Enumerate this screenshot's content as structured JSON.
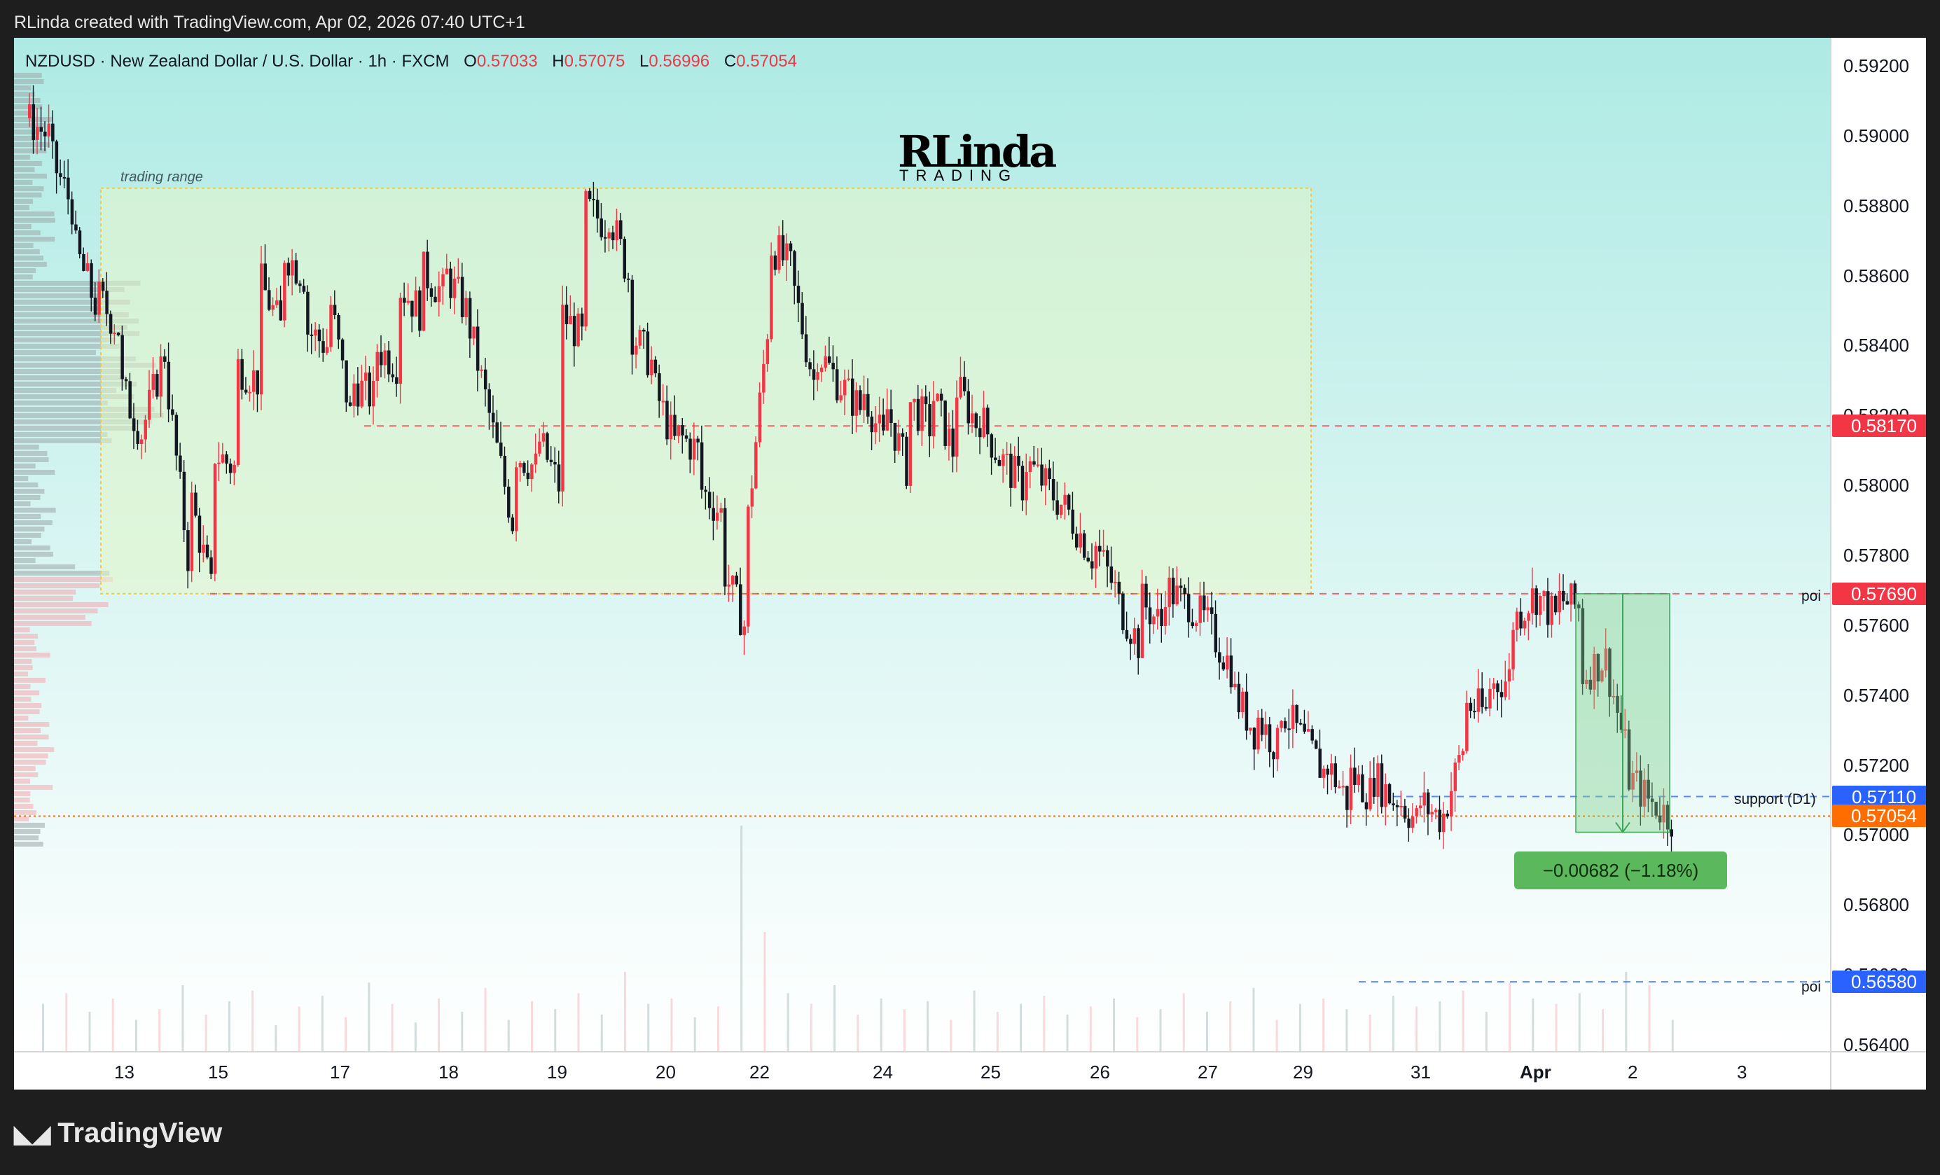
{
  "header": {
    "attribution": "RLinda created with TradingView.com, Apr 02, 2026 07:40 UTC+1"
  },
  "legend": {
    "title": "NZDUSD · New Zealand Dollar / U.S. Dollar · 1h · FXCM",
    "open_label": "O",
    "open": "0.57033",
    "high_label": "H",
    "high": "0.57075",
    "low_label": "L",
    "low": "0.56996",
    "close_label": "C",
    "close": "0.57054"
  },
  "brand": {
    "logo_letters": "RLinda",
    "logo_sub": "TRADING"
  },
  "annotations": {
    "trading_range": "trading range",
    "poi_upper": "poi",
    "support": "support (D1)",
    "poi_lower": "poi",
    "measure": "−0.00682 (−1.18%)"
  },
  "price_tags": {
    "level_1": "0.58170",
    "level_2": "0.57690",
    "support": "0.57110",
    "last": "0.57054",
    "level_3": "0.56580"
  },
  "footer": {
    "logo": "TradingView"
  },
  "colors": {
    "up": "#f23645",
    "down": "#131722",
    "level_red": "#f23645",
    "level_blue": "#2962ff",
    "last_price": "#ff6d00",
    "range_border": "#f5c842",
    "measure_fill": "#7fd08a",
    "measure_label": "#5cb85c"
  },
  "chart_data": {
    "type": "candlestick",
    "symbol": "NZDUSD",
    "interval": "1h",
    "y_ticks": [
      "0.59200",
      "0.59000",
      "0.58800",
      "0.58600",
      "0.58400",
      "0.58200",
      "0.58000",
      "0.57800",
      "0.57600",
      "0.57400",
      "0.57200",
      "0.57000",
      "0.56800",
      "0.56600",
      "0.56400"
    ],
    "x_ticks": [
      "13",
      "15",
      "17",
      "18",
      "19",
      "20",
      "22",
      "24",
      "25",
      "26",
      "27",
      "29",
      "31",
      "Apr",
      "2",
      "3"
    ],
    "ylim": [
      0.5638,
      0.5928
    ],
    "trading_range": [
      0.5769,
      0.5885
    ],
    "levels": [
      {
        "price": 0.5817,
        "color": "red"
      },
      {
        "price": 0.5769,
        "color": "red",
        "label": "poi"
      },
      {
        "price": 0.5711,
        "color": "blue",
        "label": "support (D1)"
      },
      {
        "price": 0.5658,
        "color": "blue",
        "label": "poi"
      }
    ],
    "measure": {
      "from": 0.5769,
      "to": 0.57008,
      "change": -0.00682,
      "percent": -1.18
    },
    "path": [
      [
        0.5905,
        0.59
      ],
      [
        0.5895,
        0.588
      ],
      [
        0.587,
        0.5852
      ],
      [
        0.5855,
        0.5845
      ],
      [
        0.583,
        0.5815
      ],
      [
        0.5815,
        0.5838
      ],
      [
        0.5835,
        0.578
      ],
      [
        0.58,
        0.577
      ],
      [
        0.581,
        0.5805
      ],
      [
        0.5835,
        0.583
      ],
      [
        0.586,
        0.5845
      ],
      [
        0.5868,
        0.586
      ],
      [
        0.5845,
        0.584
      ],
      [
        0.5858,
        0.582
      ],
      [
        0.583,
        0.5825
      ],
      [
        0.584,
        0.5835
      ],
      [
        0.5858,
        0.585
      ],
      [
        0.5862,
        0.5855
      ],
      [
        0.5862,
        0.585
      ],
      [
        0.585,
        0.582
      ],
      [
        0.582,
        0.579
      ],
      [
        0.581,
        0.5805
      ],
      [
        0.5815,
        0.58
      ],
      [
        0.585,
        0.5842
      ],
      [
        0.588,
        0.5875
      ],
      [
        0.5882,
        0.586
      ],
      [
        0.5845,
        0.5835
      ],
      [
        0.583,
        0.5812
      ],
      [
        0.5815,
        0.581
      ],
      [
        0.58,
        0.5792
      ],
      [
        0.5778,
        0.576
      ],
      [
        0.578,
        0.5845
      ],
      [
        0.587,
        0.5862
      ],
      [
        0.586,
        0.583
      ],
      [
        0.584,
        0.583
      ],
      [
        0.583,
        0.5822
      ],
      [
        0.583,
        0.5812
      ],
      [
        0.5825,
        0.5805
      ],
      [
        0.5825,
        0.5817
      ],
      [
        0.5828,
        0.581
      ],
      [
        0.583,
        0.5818
      ],
      [
        0.5822,
        0.5808
      ],
      [
        0.5808,
        0.58
      ],
      [
        0.5808,
        0.58
      ],
      [
        0.58,
        0.5792
      ],
      [
        0.5792,
        0.578
      ],
      [
        0.5785,
        0.577
      ],
      [
        0.5768,
        0.5755
      ],
      [
        0.5768,
        0.576
      ],
      [
        0.5772,
        0.5766
      ],
      [
        0.5768,
        0.576
      ],
      [
        0.576,
        0.5748
      ],
      [
        0.5742,
        0.573
      ],
      [
        0.5735,
        0.5725
      ],
      [
        0.5738,
        0.5728
      ],
      [
        0.5728,
        0.5718
      ],
      [
        0.5722,
        0.571
      ],
      [
        0.5718,
        0.5712
      ],
      [
        0.5718,
        0.571
      ],
      [
        0.5712,
        0.5704
      ],
      [
        0.571,
        0.5705
      ],
      [
        0.5702,
        0.5725
      ],
      [
        0.5738,
        0.5735
      ],
      [
        0.5742,
        0.5745
      ],
      [
        0.576,
        0.5768
      ],
      [
        0.577,
        0.5762
      ],
      [
        0.5768,
        0.5765
      ],
      [
        0.5745,
        0.575
      ],
      [
        0.5755,
        0.5725
      ],
      [
        0.5718,
        0.571
      ],
      [
        0.571,
        0.5705
      ]
    ],
    "volume_levels": [
      0.18,
      0.22,
      0.15,
      0.2,
      0.12,
      0.16,
      0.25,
      0.14,
      0.19,
      0.23,
      0.1,
      0.17,
      0.21,
      0.13,
      0.26,
      0.18,
      0.11,
      0.2,
      0.15,
      0.24,
      0.12,
      0.19,
      0.16,
      0.22,
      0.14,
      0.3,
      0.18,
      0.2,
      0.13,
      0.17,
      0.85,
      0.45,
      0.22,
      0.18,
      0.25,
      0.14,
      0.2,
      0.16,
      0.19,
      0.12,
      0.23,
      0.15,
      0.18,
      0.21,
      0.14,
      0.17,
      0.2,
      0.13,
      0.16,
      0.22,
      0.15,
      0.19,
      0.24,
      0.12,
      0.18,
      0.2,
      0.16,
      0.14,
      0.21,
      0.17,
      0.19,
      0.23,
      0.15,
      0.26,
      0.2,
      0.18,
      0.22,
      0.16,
      0.3,
      0.25,
      0.12
    ]
  }
}
